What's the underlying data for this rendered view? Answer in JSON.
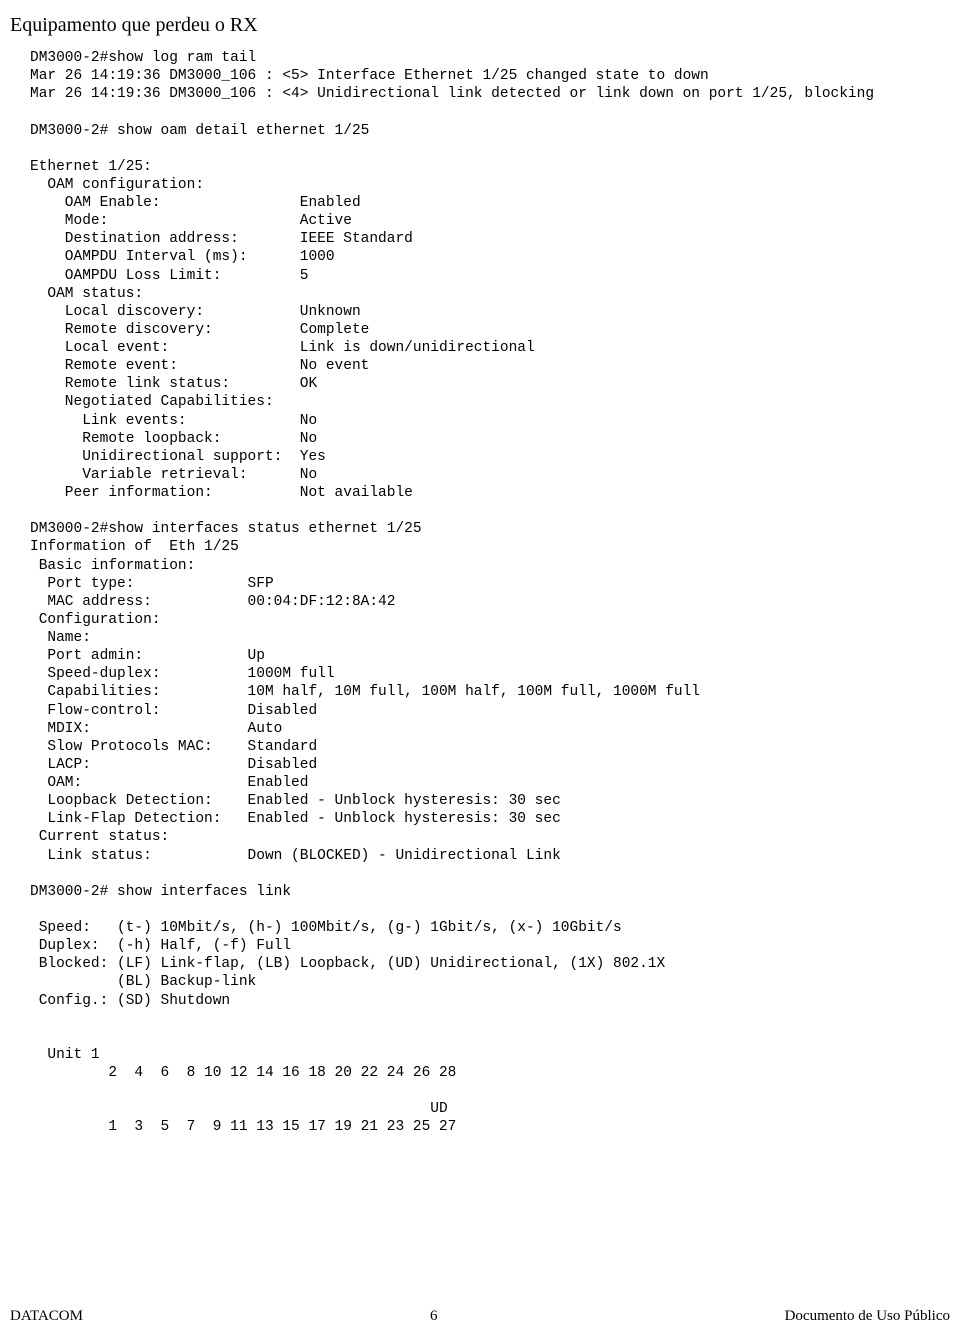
{
  "title": "Equipamento que perdeu o RX",
  "log_block": "DM3000-2#show log ram tail\nMar 26 14:19:36 DM3000_106 : <5> Interface Ethernet 1/25 changed state to down\nMar 26 14:19:36 DM3000_106 : <4> Unidirectional link detected or link down on port 1/25, blocking",
  "oam_cmd": "DM3000-2# show oam detail ethernet 1/25",
  "oam_block": "Ethernet 1/25:\n  OAM configuration:\n    OAM Enable:                Enabled\n    Mode:                      Active\n    Destination address:       IEEE Standard\n    OAMPDU Interval (ms):      1000\n    OAMPDU Loss Limit:         5\n  OAM status:\n    Local discovery:           Unknown\n    Remote discovery:          Complete\n    Local event:               Link is down/unidirectional\n    Remote event:              No event\n    Remote link status:        OK\n    Negotiated Capabilities:\n      Link events:             No\n      Remote loopback:         No\n      Unidirectional support:  Yes\n      Variable retrieval:      No\n    Peer information:          Not available",
  "if_status_cmd": "DM3000-2#show interfaces status ethernet 1/25",
  "if_status_block": "Information of  Eth 1/25\n Basic information:\n  Port type:             SFP\n  MAC address:           00:04:DF:12:8A:42\n Configuration:\n  Name:\n  Port admin:            Up\n  Speed-duplex:          1000M full\n  Capabilities:          10M half, 10M full, 100M half, 100M full, 1000M full\n  Flow-control:          Disabled\n  MDIX:                  Auto\n  Slow Protocols MAC:    Standard\n  LACP:                  Disabled\n  OAM:                   Enabled\n  Loopback Detection:    Enabled - Unblock hysteresis: 30 sec\n  Link-Flap Detection:   Enabled - Unblock hysteresis: 30 sec\n Current status:\n  Link status:           Down (BLOCKED) - Unidirectional Link",
  "if_link_cmd": "DM3000-2# show interfaces link",
  "legend_block": " Speed:   (t-) 10Mbit/s, (h-) 100Mbit/s, (g-) 1Gbit/s, (x-) 10Gbit/s\n Duplex:  (-h) Half, (-f) Full\n Blocked: (LF) Link-flap, (LB) Loopback, (UD) Unidirectional, (1X) 802.1X\n          (BL) Backup-link\n Config.: (SD) Shutdown",
  "unit_block": "  Unit 1\n         2  4  6  8 10 12 14 16 18 20 22 24 26 28\n\n                                              UD\n         1  3  5  7  9 11 13 15 17 19 21 23 25 27",
  "footer_left": "DATACOM",
  "footer_center": "6",
  "footer_right": "Documento de Uso Público"
}
